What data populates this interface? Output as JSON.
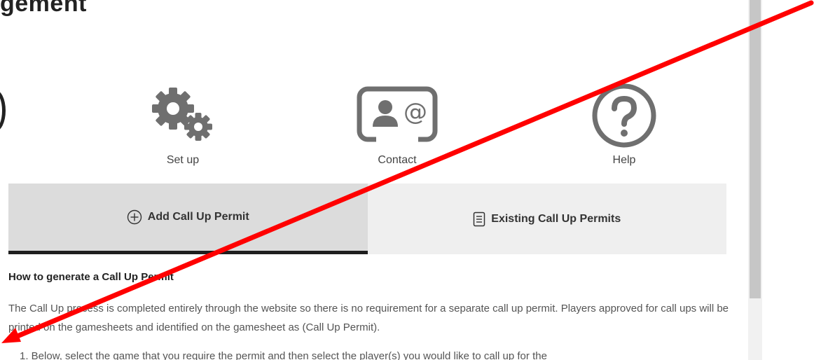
{
  "page": {
    "title": "gement"
  },
  "quick_links": [
    {
      "label": "Set up",
      "icon": "gears-icon"
    },
    {
      "label": "Contact",
      "icon": "contact-card-icon"
    },
    {
      "label": "Help",
      "icon": "question-circle-icon"
    }
  ],
  "tabs": [
    {
      "label": "Add Call Up Permit",
      "icon": "plus-circle-icon",
      "active": true
    },
    {
      "label": "Existing Call Up Permits",
      "icon": "document-icon",
      "active": false
    }
  ],
  "content": {
    "heading": "How to generate a Call Up Permit",
    "paragraph": "The Call Up process is completed entirely through the website so there is no requirement for a separate call up permit. Players approved for call ups will be printed on the gamesheets and identified on the gamesheet as (Call Up Permit).",
    "list_item": "1. Below, select the game that you require the permit and then select the player(s) you would like to call up for the"
  },
  "colors": {
    "accent_active_tab": "#1f1f1f",
    "icon_gray": "#6f6f6f",
    "annotation_arrow": "#ff0000"
  }
}
